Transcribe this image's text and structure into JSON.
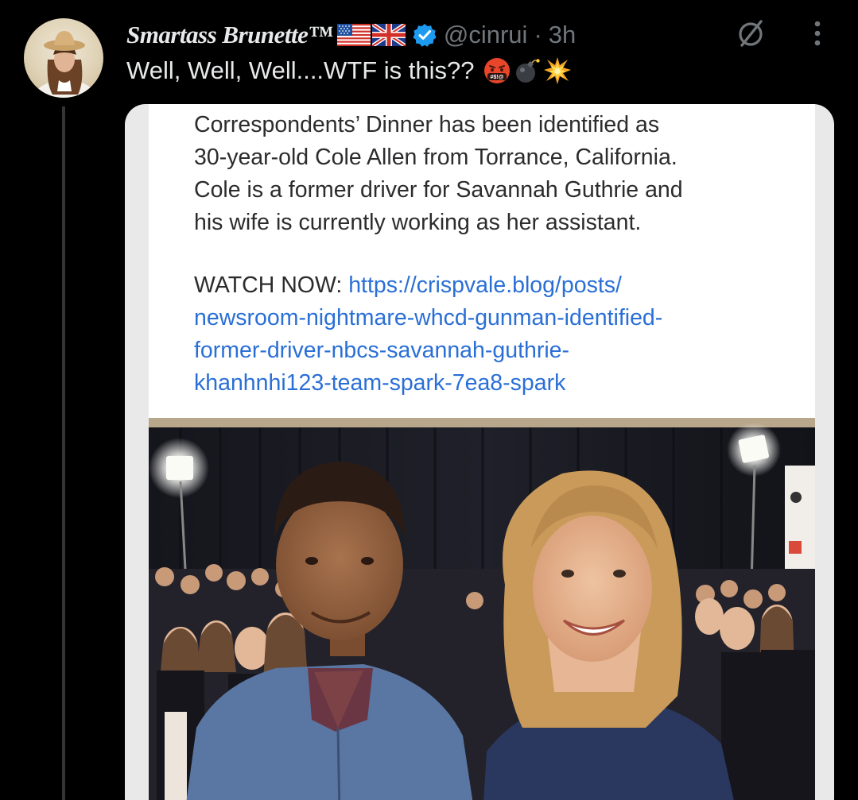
{
  "tweet": {
    "display_name": "Smartass Brunette™",
    "flags": [
      "us-flag-icon",
      "uk-flag-icon"
    ],
    "handle": "@cinrui",
    "separator": "·",
    "time": "3h",
    "text": "Well,  Well, Well....WTF is this??",
    "emojis": [
      "face-with-symbols-icon",
      "bomb-icon",
      "collision-icon"
    ]
  },
  "media": {
    "card_lines": [
      "Correspondents’ Dinner has been identified as",
      "30-year-old Cole Allen from Torrance, California.",
      "Cole is a former driver for Savannah Guthrie and",
      "his wife is currently working as her assistant."
    ],
    "watch_label": "WATCH NOW: ",
    "link_lines": [
      "https://crispvale.blog/posts/",
      "newsroom-nightmare-whcd-gunman-identified-",
      "former-driver-nbcs-savannah-guthrie-",
      "khanhnhi123-team-spark-7ea8-spark"
    ]
  },
  "colors": {
    "background": "#000000",
    "text": "#e7e9ea",
    "muted": "#71767b",
    "verified": "#1d9bf0",
    "link": "#2a6fd6"
  }
}
